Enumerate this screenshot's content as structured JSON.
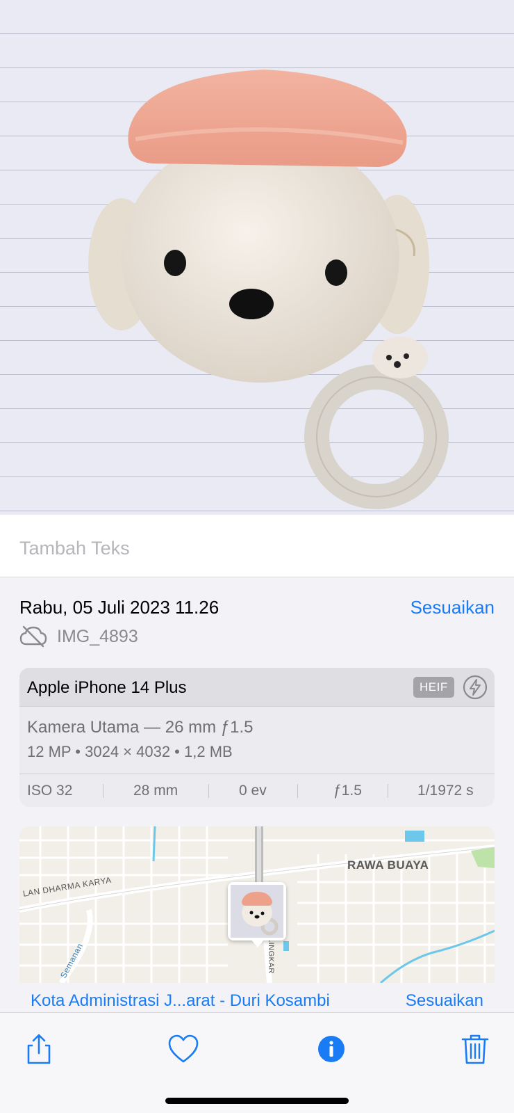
{
  "caption": {
    "placeholder": "Tambah Teks"
  },
  "info": {
    "date": "Rabu, 05 Juli 2023 11.26",
    "adjust_label": "Sesuaikan",
    "filename": "IMG_4893",
    "cloud_icon": "icloud-off-icon"
  },
  "camera": {
    "device": "Apple iPhone 14 Plus",
    "format": "HEIF",
    "flash_icon": "flash-off-icon",
    "lens": "Kamera Utama — 26 mm ƒ1.5",
    "specs": "12 MP  •  3024 × 4032  •  1,2 MB",
    "exif": {
      "iso": "ISO 32",
      "focal": "28 mm",
      "ev": "0 ev",
      "aperture": "ƒ1.5",
      "shutter": "1/1972 s"
    }
  },
  "map": {
    "labels": {
      "district": "RAWA BUAYA",
      "street_1": "LAN DHARMA KARYA",
      "street_2": "Semanan",
      "street_3": "LINGKAR"
    },
    "location": "Kota Administrasi J...arat - Duri Kosambi",
    "adjust_label": "Sesuaikan"
  },
  "toolbar": {
    "share": "share-icon",
    "favorite": "heart-icon",
    "info": "info-icon",
    "delete": "trash-icon",
    "accent": "#1a7cf5"
  }
}
